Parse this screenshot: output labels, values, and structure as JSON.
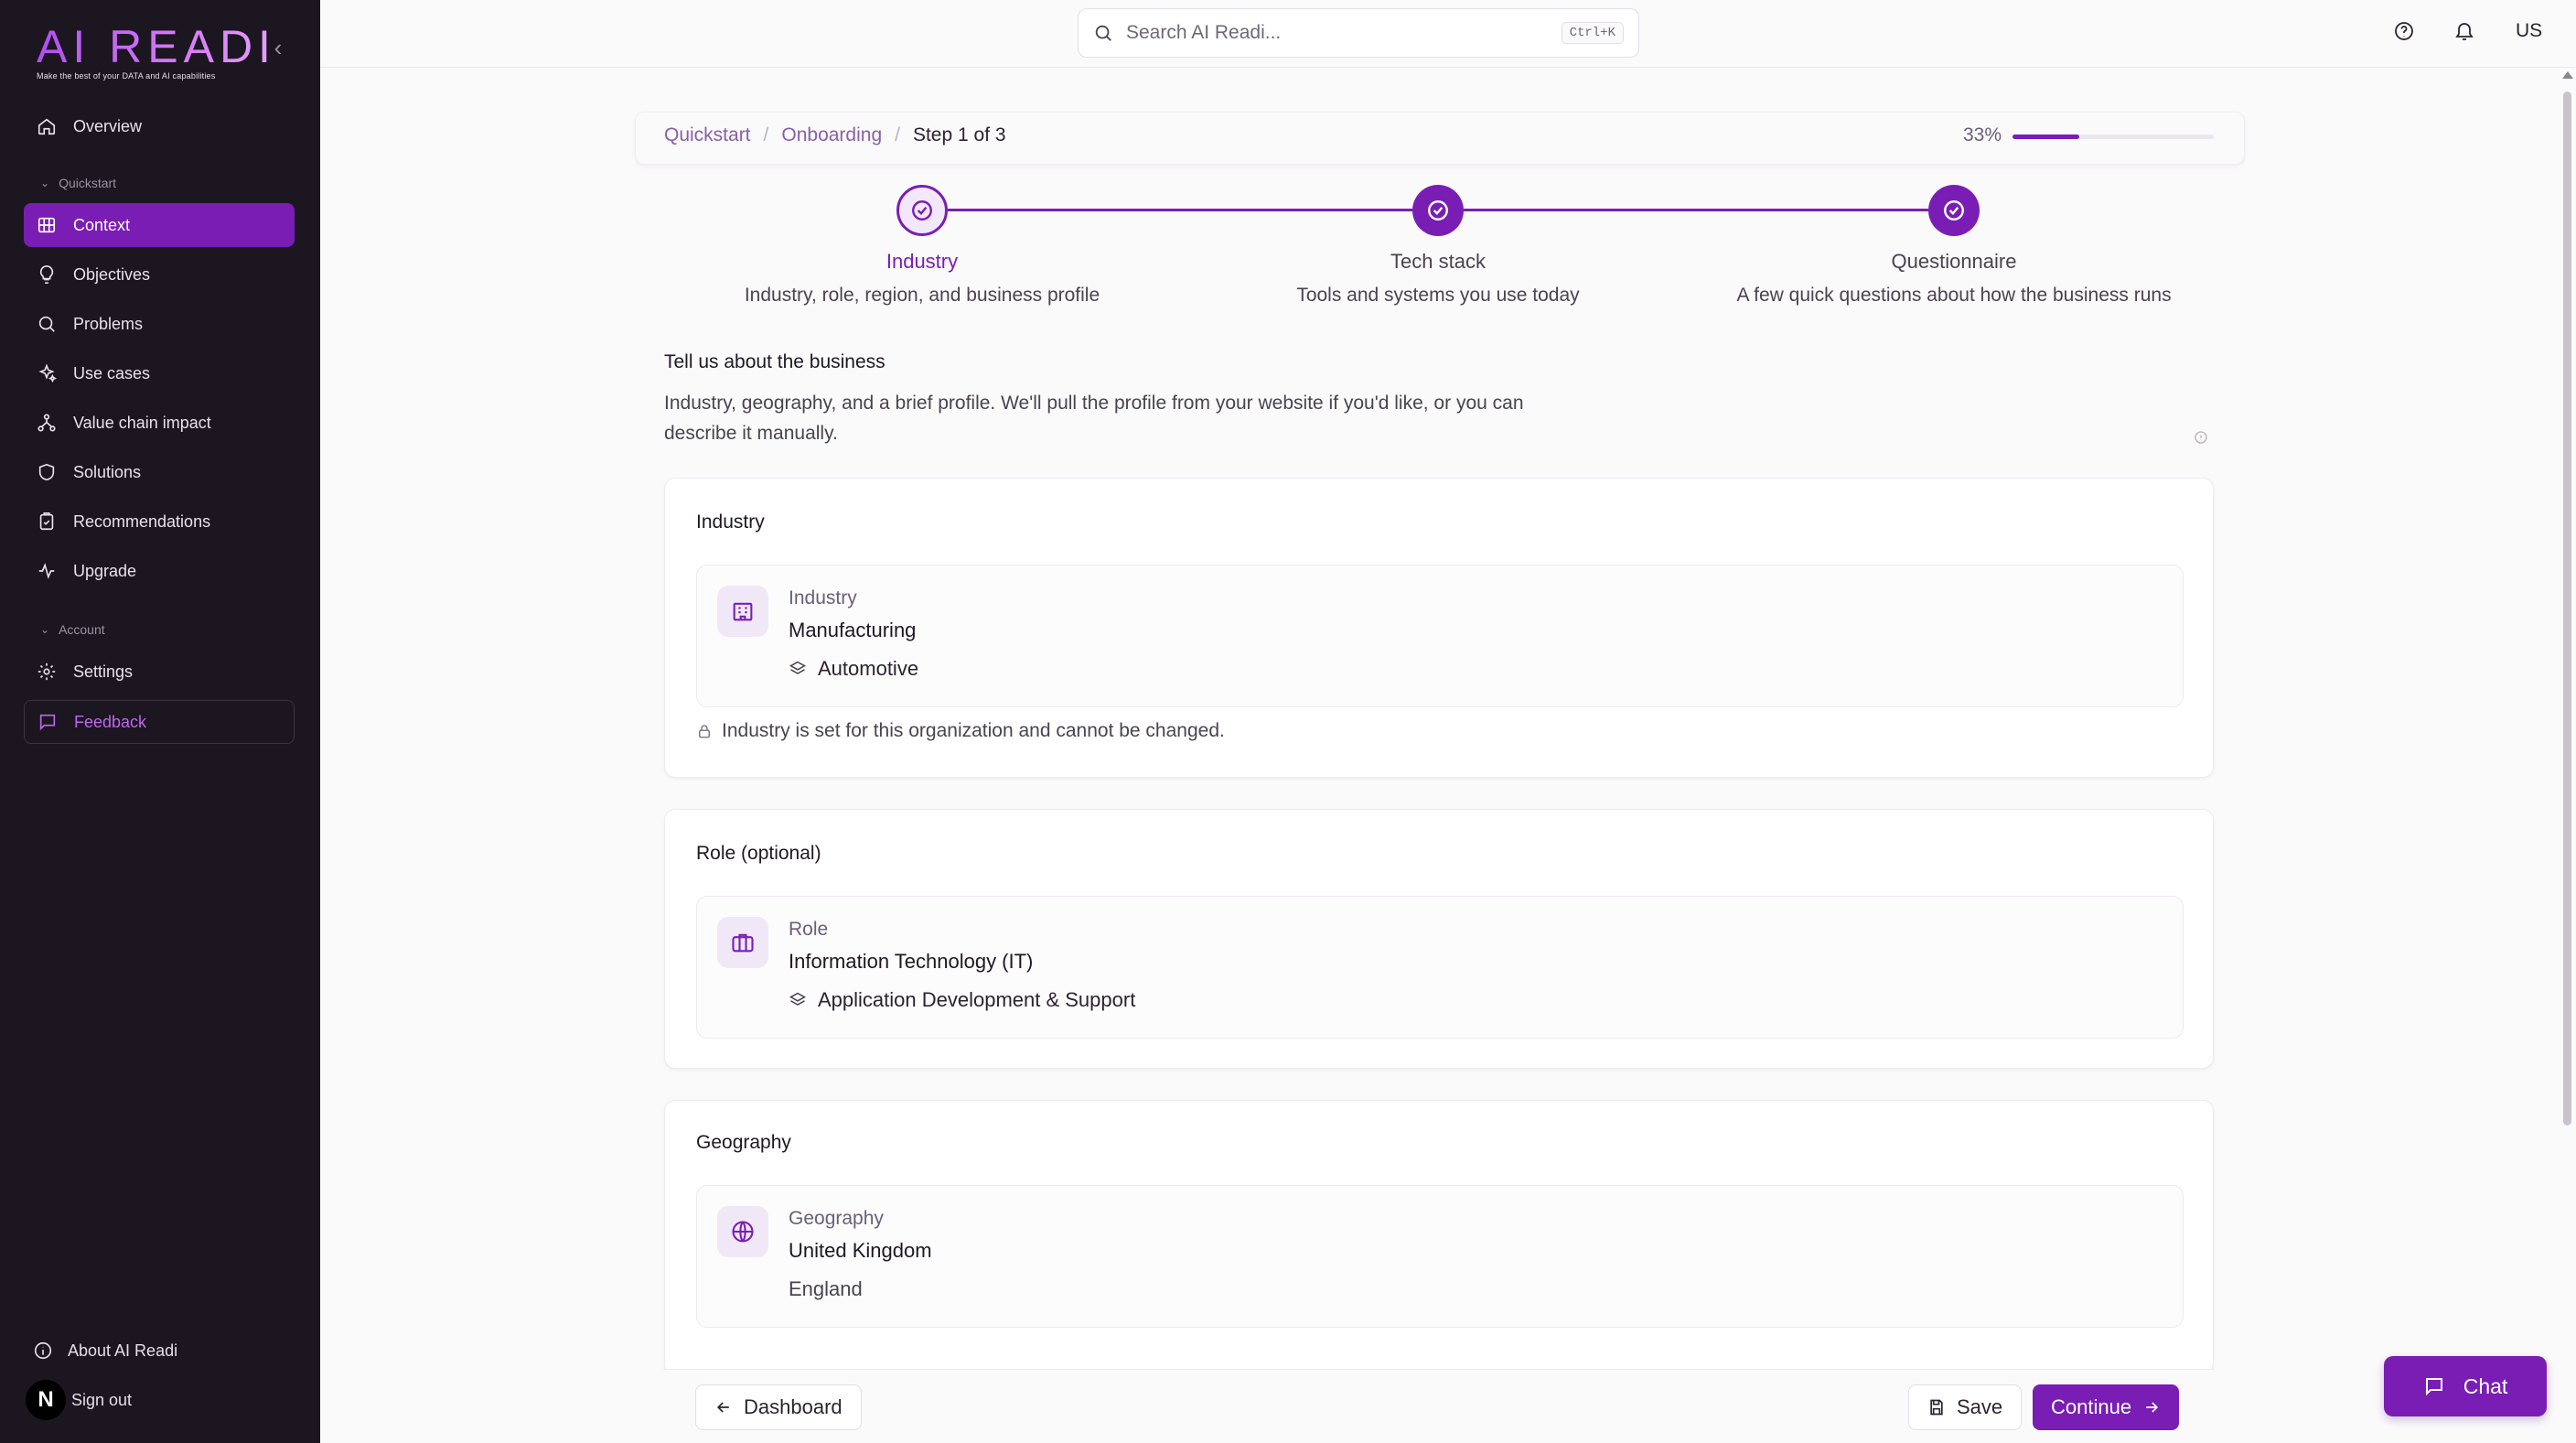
{
  "brand": {
    "logo_text": "AI READI",
    "tagline": "Make the best of your DATA and AI capabilities"
  },
  "sidebar": {
    "items_top": [
      {
        "label": "Overview",
        "icon": "home-icon"
      }
    ],
    "section_quickstart": "Quickstart",
    "items_quickstart": [
      {
        "label": "Context",
        "icon": "building-icon",
        "active": true
      },
      {
        "label": "Objectives",
        "icon": "lightbulb-icon"
      },
      {
        "label": "Problems",
        "icon": "search-icon"
      },
      {
        "label": "Use cases",
        "icon": "sparkles-icon"
      },
      {
        "label": "Value chain impact",
        "icon": "network-icon"
      },
      {
        "label": "Solutions",
        "icon": "shield-icon"
      },
      {
        "label": "Recommendations",
        "icon": "clipboard-check-icon"
      },
      {
        "label": "Upgrade",
        "icon": "activity-icon"
      }
    ],
    "section_account": "Account",
    "items_account": [
      {
        "label": "Settings",
        "icon": "gear-icon"
      },
      {
        "label": "Feedback",
        "icon": "message-icon"
      }
    ],
    "bottom": {
      "about": "About AI Readi",
      "sign_out": "Sign out",
      "avatar_letter": "N"
    }
  },
  "topbar": {
    "search_placeholder": "Search AI Readi...",
    "search_shortcut": "Ctrl+K",
    "language": "US"
  },
  "breadcrumb": [
    "Quickstart",
    "Onboarding",
    "Step 1 of 3"
  ],
  "progress": {
    "label": "33%",
    "value": 0.33
  },
  "steps": [
    {
      "title": "Industry",
      "description": "Industry, role, region, and business profile",
      "state": "current"
    },
    {
      "title": "Tech stack",
      "description": "Tools and systems you use today",
      "state": "complete"
    },
    {
      "title": "Questionnaire",
      "description": "A few quick questions about how the business runs",
      "state": "complete"
    }
  ],
  "intro": {
    "title": "Tell us about the business",
    "text": "Industry, geography, and a brief profile. We'll pull the profile from your website if you'd like, or you can describe it manually."
  },
  "cards": {
    "industry": {
      "title": "Industry",
      "label": "Industry",
      "value": "Manufacturing",
      "sub": "Automotive",
      "note": "Industry is set for this organization and cannot be changed."
    },
    "role": {
      "title": "Role (optional)",
      "label": "Role",
      "value": "Information Technology (IT)",
      "sub": "Application Development & Support"
    },
    "geography": {
      "title": "Geography",
      "label": "Geography",
      "value": "United Kingdom",
      "sub": "England"
    }
  },
  "footer": {
    "dashboard": "Dashboard",
    "save": "Save",
    "continue": "Continue"
  },
  "chat": {
    "label": "Chat"
  },
  "colors": {
    "accent": "#7a1db5",
    "sidebar_bg": "#1b1620",
    "page_bg": "#fbfafb"
  }
}
